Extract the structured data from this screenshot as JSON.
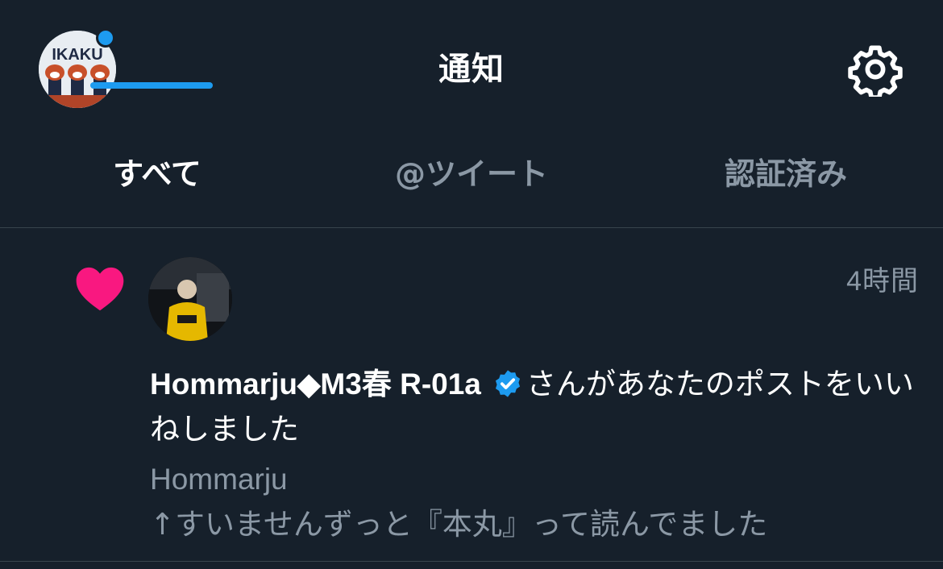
{
  "header": {
    "title": "通知",
    "avatar_text": "IKAKU",
    "settings_icon": "gear-icon"
  },
  "tabs": [
    {
      "label": "すべて",
      "active": true
    },
    {
      "label": "@ツイート",
      "active": false
    },
    {
      "label": "認証済み",
      "active": false
    }
  ],
  "notification": {
    "type_icon": "heart-icon",
    "time": "4時間",
    "actor_name": "Hommarju◆M3春 R-01a",
    "verified_icon": "verified-badge-icon",
    "action_text": "さんがあなたのポストをいいねしました",
    "tweet_author": "Hommarju",
    "tweet_text": "↑すいませんずっと『本丸』って読んでました"
  },
  "colors": {
    "background": "#16202b",
    "accent": "#1d9bf0",
    "heart": "#f91880",
    "muted_text": "#8b98a5",
    "divider": "#38444d"
  }
}
